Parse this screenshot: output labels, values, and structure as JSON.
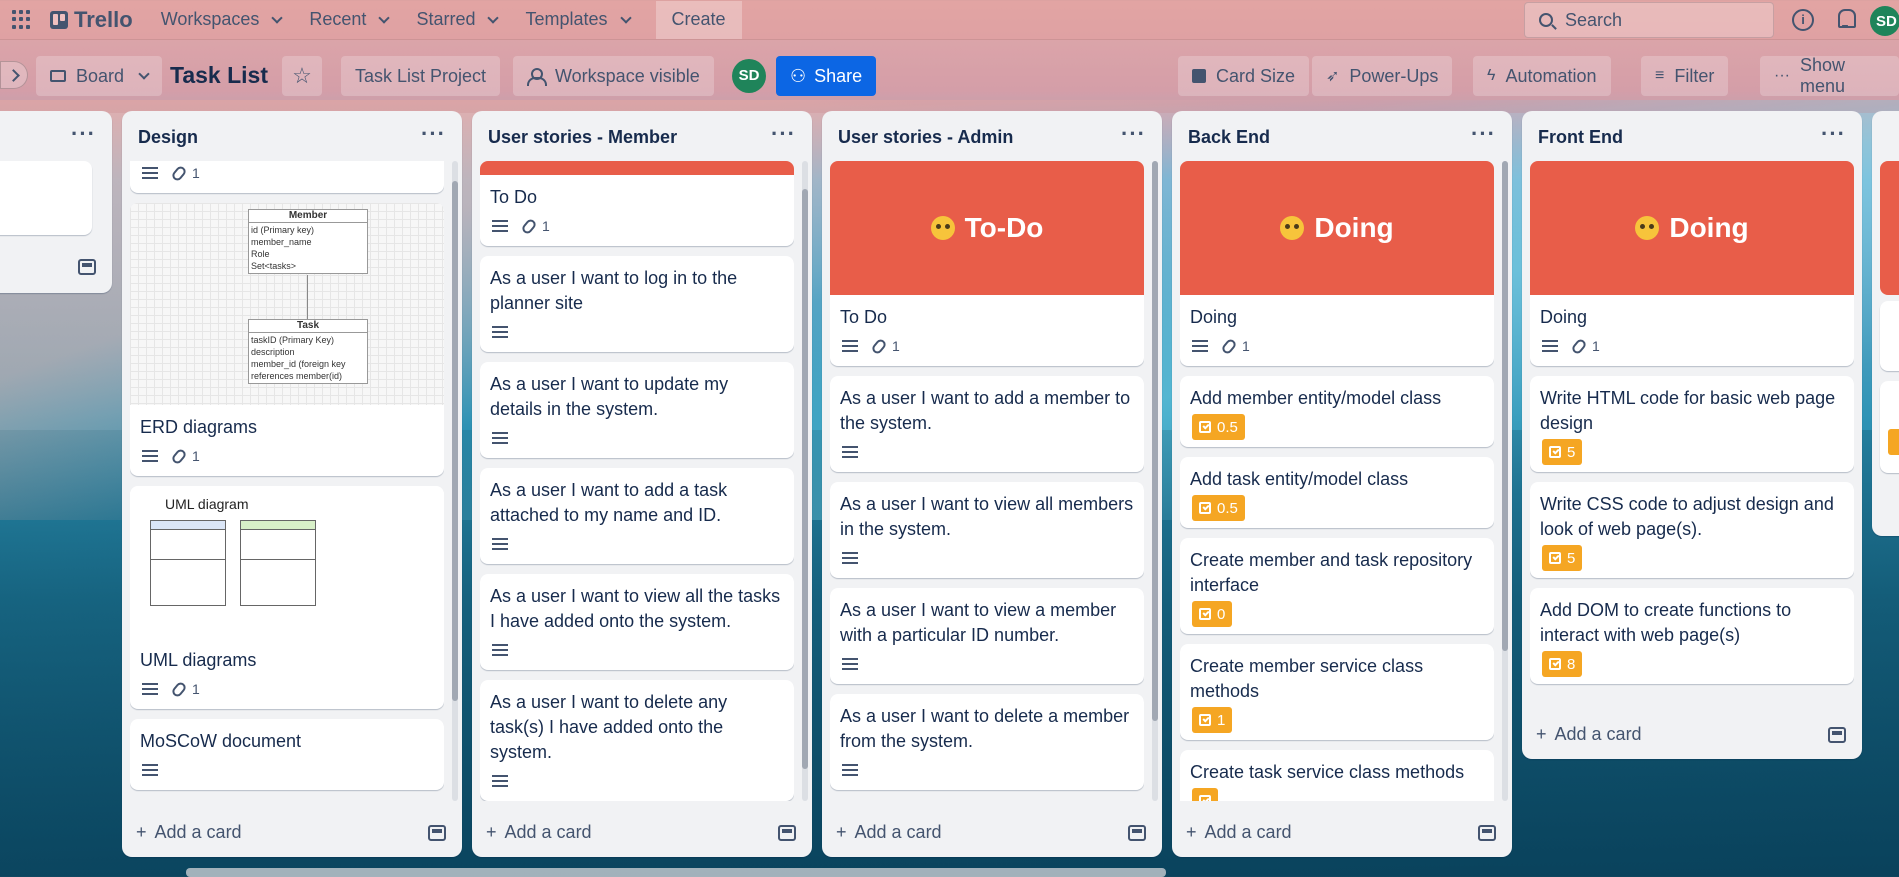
{
  "topnav": {
    "brand": "Trello",
    "items": [
      "Workspaces",
      "Recent",
      "Starred",
      "Templates"
    ],
    "create": "Create",
    "search_placeholder": "Search",
    "avatar": "SD"
  },
  "board": {
    "view": "Board",
    "title": "Task List",
    "project": "Task List Project",
    "visibility": "Workspace visible",
    "member_avatar": "SD",
    "share": "Share",
    "card_size": "Card Size",
    "power_ups": "Power-Ups",
    "automation": "Automation",
    "filter": "Filter",
    "show_menu": "Show menu"
  },
  "add_card": "Add a card",
  "lists": [
    {
      "title": "Design",
      "cards": [
        {
          "attachments": "1"
        },
        {
          "title": "ERD diagrams",
          "attachments": "1",
          "image": {
            "member_title": "Member",
            "member_fields": [
              "id (Primary key)",
              "member_name",
              "Role",
              "Set<tasks>"
            ],
            "task_title": "Task",
            "task_fields": [
              "taskID (Primary Key)",
              "description",
              "member_id (foreign key",
              "references member(id)"
            ]
          }
        },
        {
          "title": "UML diagrams",
          "attachments": "1",
          "image": {
            "caption": "UML diagram"
          }
        },
        {
          "title": "MoSCoW document"
        }
      ]
    },
    {
      "title": "User stories - Member",
      "cards": [
        {
          "title": "To Do",
          "attachments": "1"
        },
        {
          "title": "As a user I want to log in to the planner site"
        },
        {
          "title": "As a user I want to update my details in the system."
        },
        {
          "title": "As a user I want to add a task attached to my name and ID."
        },
        {
          "title": "As a user I want to view all the tasks I have added onto the system."
        },
        {
          "title": "As a user I want to delete any task(s) I have added onto the system."
        }
      ]
    },
    {
      "title": "User stories - Admin",
      "cover": "To-Do",
      "cards": [
        {
          "title": "To Do",
          "attachments": "1"
        },
        {
          "title": "As a user I want to add a member to the system."
        },
        {
          "title": "As a user I want to view all members in the system."
        },
        {
          "title": "As a user I want to view a member with a particular ID number."
        },
        {
          "title": "As a user I want to delete a member from the system."
        }
      ]
    },
    {
      "title": "Back End",
      "cover": "Doing",
      "cards": [
        {
          "title": "Doing",
          "attachments": "1"
        },
        {
          "title": "Add member entity/model class",
          "points": "0.5"
        },
        {
          "title": "Add task entity/model class",
          "points": "0.5"
        },
        {
          "title": "Create member and task repository interface",
          "points": "0"
        },
        {
          "title": "Create member service class methods",
          "points": "1"
        },
        {
          "title": "Create task service class methods"
        }
      ]
    },
    {
      "title": "Front End",
      "cover": "Doing",
      "cards": [
        {
          "title": "Doing",
          "attachments": "1"
        },
        {
          "title": "Write HTML code for basic web page design",
          "points": "5"
        },
        {
          "title": "Write CSS code to adjust design and look of web page(s).",
          "points": "5"
        },
        {
          "title": "Add DOM to create functions to interact with web page(s)",
          "points": "8"
        }
      ]
    }
  ],
  "list_menu": "···",
  "colors": {
    "cover": "#e85d49",
    "points": "#f5a623",
    "share": "#0c66e4",
    "avatar": "#1f845a"
  }
}
